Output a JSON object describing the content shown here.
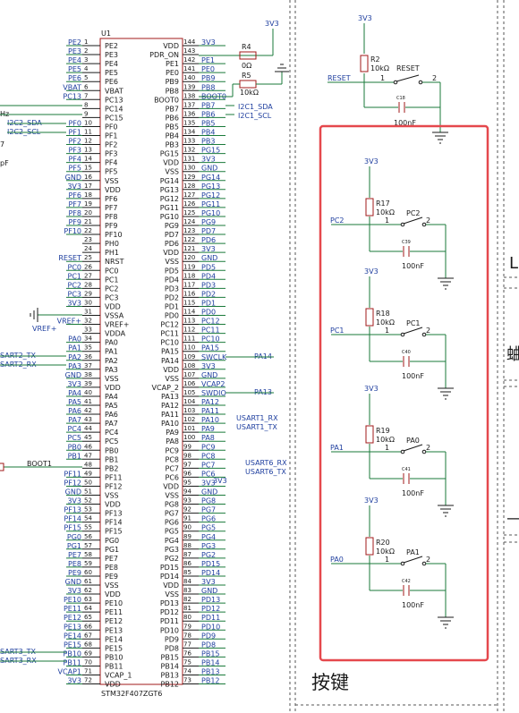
{
  "mcu": {
    "designator": "U1",
    "part": "STM32F407ZGT6",
    "left_pins": [
      {
        "num": "1",
        "name": "PE2",
        "net": "PE2"
      },
      {
        "num": "2",
        "name": "PE3",
        "net": "PE3"
      },
      {
        "num": "3",
        "name": "PE4",
        "net": "PE4"
      },
      {
        "num": "4",
        "name": "PE5",
        "net": "PE5"
      },
      {
        "num": "5",
        "name": "PE6",
        "net": "PE6"
      },
      {
        "num": "6",
        "name": "VBAT",
        "net": "VBAT"
      },
      {
        "num": "7",
        "name": "PC13",
        "net": "PC13"
      },
      {
        "num": "8",
        "name": "PC14",
        "net": ""
      },
      {
        "num": "9",
        "name": "PC15",
        "net": ""
      },
      {
        "num": "10",
        "name": "PF0",
        "net": "PF0"
      },
      {
        "num": "11",
        "name": "PF1",
        "net": "PF1"
      },
      {
        "num": "12",
        "name": "PF2",
        "net": "PF2"
      },
      {
        "num": "13",
        "name": "PF3",
        "net": "PF3"
      },
      {
        "num": "14",
        "name": "PF4",
        "net": "PF4"
      },
      {
        "num": "15",
        "name": "PF5",
        "net": "PF5"
      },
      {
        "num": "16",
        "name": "VSS",
        "net": "GND"
      },
      {
        "num": "17",
        "name": "VDD",
        "net": "3V3"
      },
      {
        "num": "18",
        "name": "PF6",
        "net": "PF6"
      },
      {
        "num": "19",
        "name": "PF7",
        "net": "PF7"
      },
      {
        "num": "20",
        "name": "PF8",
        "net": "PF8"
      },
      {
        "num": "21",
        "name": "PF9",
        "net": "PF9"
      },
      {
        "num": "22",
        "name": "PF10",
        "net": "PF10"
      },
      {
        "num": "23",
        "name": "PH0",
        "net": ""
      },
      {
        "num": "24",
        "name": "PH1",
        "net": ""
      },
      {
        "num": "25",
        "name": "NRST",
        "net": "RESET"
      },
      {
        "num": "26",
        "name": "PC0",
        "net": "PC0"
      },
      {
        "num": "27",
        "name": "PC1",
        "net": "PC1"
      },
      {
        "num": "28",
        "name": "PC2",
        "net": "PC2"
      },
      {
        "num": "29",
        "name": "PC3",
        "net": "PC3"
      },
      {
        "num": "30",
        "name": "VDD",
        "net": "3V3"
      },
      {
        "num": "31",
        "name": "VSSA",
        "net": ""
      },
      {
        "num": "32",
        "name": "VREF+",
        "net": "VREF+"
      },
      {
        "num": "33",
        "name": "VDDA",
        "net": ""
      },
      {
        "num": "34",
        "name": "PA0",
        "net": "PA0"
      },
      {
        "num": "35",
        "name": "PA1",
        "net": "PA1"
      },
      {
        "num": "36",
        "name": "PA2",
        "net": "PA2"
      },
      {
        "num": "37",
        "name": "PA3",
        "net": "PA3"
      },
      {
        "num": "38",
        "name": "VSS",
        "net": "GND"
      },
      {
        "num": "39",
        "name": "VDD",
        "net": "3V3"
      },
      {
        "num": "40",
        "name": "PA4",
        "net": "PA4"
      },
      {
        "num": "41",
        "name": "PA5",
        "net": "PA5"
      },
      {
        "num": "42",
        "name": "PA6",
        "net": "PA6"
      },
      {
        "num": "43",
        "name": "PA7",
        "net": "PA7"
      },
      {
        "num": "44",
        "name": "PC4",
        "net": "PC4"
      },
      {
        "num": "45",
        "name": "PC5",
        "net": "PC5"
      },
      {
        "num": "46",
        "name": "PB0",
        "net": "PB0"
      },
      {
        "num": "47",
        "name": "PB1",
        "net": "PB1"
      },
      {
        "num": "48",
        "name": "PB2",
        "net": ""
      },
      {
        "num": "49",
        "name": "PF11",
        "net": "PF11"
      },
      {
        "num": "50",
        "name": "PF12",
        "net": "PF12"
      },
      {
        "num": "51",
        "name": "VSS",
        "net": "GND"
      },
      {
        "num": "52",
        "name": "VDD",
        "net": "3V3"
      },
      {
        "num": "53",
        "name": "PF13",
        "net": "PF13"
      },
      {
        "num": "54",
        "name": "PF14",
        "net": "PF14"
      },
      {
        "num": "55",
        "name": "PF15",
        "net": "PF15"
      },
      {
        "num": "56",
        "name": "PG0",
        "net": "PG0"
      },
      {
        "num": "57",
        "name": "PG1",
        "net": "PG1"
      },
      {
        "num": "58",
        "name": "PE7",
        "net": "PE7"
      },
      {
        "num": "59",
        "name": "PE8",
        "net": "PE8"
      },
      {
        "num": "60",
        "name": "PE9",
        "net": "PE9"
      },
      {
        "num": "61",
        "name": "VSS",
        "net": "GND"
      },
      {
        "num": "62",
        "name": "VDD",
        "net": "3V3"
      },
      {
        "num": "63",
        "name": "PE10",
        "net": "PE10"
      },
      {
        "num": "64",
        "name": "PE11",
        "net": "PE11"
      },
      {
        "num": "65",
        "name": "PE12",
        "net": "PE12"
      },
      {
        "num": "66",
        "name": "PE13",
        "net": "PE13"
      },
      {
        "num": "67",
        "name": "PE14",
        "net": "PE14"
      },
      {
        "num": "68",
        "name": "PE15",
        "net": "PE15"
      },
      {
        "num": "69",
        "name": "PB10",
        "net": "PB10"
      },
      {
        "num": "70",
        "name": "PB11",
        "net": "PB11"
      },
      {
        "num": "71",
        "name": "VCAP_1",
        "net": "VCAP1"
      },
      {
        "num": "72",
        "name": "VDD",
        "net": "3V3"
      }
    ],
    "right_pins": [
      {
        "num": "144",
        "name": "VDD",
        "net": "3V3"
      },
      {
        "num": "143",
        "name": "PDR_ON",
        "net": ""
      },
      {
        "num": "142",
        "name": "PE1",
        "net": "PE1"
      },
      {
        "num": "141",
        "name": "PE0",
        "net": "PE0"
      },
      {
        "num": "140",
        "name": "PB9",
        "net": "PB9"
      },
      {
        "num": "139",
        "name": "PB8",
        "net": "PB8"
      },
      {
        "num": "138",
        "name": "BOOT0",
        "net": "BOOT0"
      },
      {
        "num": "137",
        "name": "PB7",
        "net": "PB7"
      },
      {
        "num": "136",
        "name": "PB6",
        "net": "PB6"
      },
      {
        "num": "135",
        "name": "PB5",
        "net": "PB5"
      },
      {
        "num": "134",
        "name": "PB4",
        "net": "PB4"
      },
      {
        "num": "133",
        "name": "PB3",
        "net": "PB3"
      },
      {
        "num": "132",
        "name": "PG15",
        "net": "PG15"
      },
      {
        "num": "131",
        "name": "VDD",
        "net": "3V3"
      },
      {
        "num": "130",
        "name": "VSS",
        "net": "GND"
      },
      {
        "num": "129",
        "name": "PG14",
        "net": "PG14"
      },
      {
        "num": "128",
        "name": "PG13",
        "net": "PG13"
      },
      {
        "num": "127",
        "name": "PG12",
        "net": "PG12"
      },
      {
        "num": "126",
        "name": "PG11",
        "net": "PG11"
      },
      {
        "num": "125",
        "name": "PG10",
        "net": "PG10"
      },
      {
        "num": "124",
        "name": "PG9",
        "net": "PG9"
      },
      {
        "num": "123",
        "name": "PD7",
        "net": "PD7"
      },
      {
        "num": "122",
        "name": "PD6",
        "net": "PD6"
      },
      {
        "num": "121",
        "name": "VDD",
        "net": "3V3"
      },
      {
        "num": "120",
        "name": "VSS",
        "net": "GND"
      },
      {
        "num": "119",
        "name": "PD5",
        "net": "PD5"
      },
      {
        "num": "118",
        "name": "PD4",
        "net": "PD4"
      },
      {
        "num": "117",
        "name": "PD3",
        "net": "PD3"
      },
      {
        "num": "116",
        "name": "PD2",
        "net": "PD2"
      },
      {
        "num": "115",
        "name": "PD1",
        "net": "PD1"
      },
      {
        "num": "114",
        "name": "PD0",
        "net": "PD0"
      },
      {
        "num": "113",
        "name": "PC12",
        "net": "PC12"
      },
      {
        "num": "112",
        "name": "PC11",
        "net": "PC11"
      },
      {
        "num": "111",
        "name": "PC10",
        "net": "PC10"
      },
      {
        "num": "110",
        "name": "PA15",
        "net": "PA15"
      },
      {
        "num": "109",
        "name": "PA14",
        "net": "SWCLK"
      },
      {
        "num": "108",
        "name": "VDD",
        "net": "3V3"
      },
      {
        "num": "107",
        "name": "VSS",
        "net": "GND"
      },
      {
        "num": "106",
        "name": "VCAP_2",
        "net": "VCAP2"
      },
      {
        "num": "105",
        "name": "PA13",
        "net": "SWDIO"
      },
      {
        "num": "104",
        "name": "PA12",
        "net": "PA12"
      },
      {
        "num": "103",
        "name": "PA11",
        "net": "PA11"
      },
      {
        "num": "102",
        "name": "PA10",
        "net": "PA10"
      },
      {
        "num": "101",
        "name": "PA9",
        "net": "PA9"
      },
      {
        "num": "100",
        "name": "PA8",
        "net": "PA8"
      },
      {
        "num": "99",
        "name": "PC9",
        "net": "PC9"
      },
      {
        "num": "98",
        "name": "PC8",
        "net": "PC8"
      },
      {
        "num": "97",
        "name": "PC7",
        "net": "PC7"
      },
      {
        "num": "96",
        "name": "PC6",
        "net": "PC6"
      },
      {
        "num": "95",
        "name": "VDD",
        "net": "3V3"
      },
      {
        "num": "94",
        "name": "VSS",
        "net": "GND"
      },
      {
        "num": "93",
        "name": "PG8",
        "net": "PG8"
      },
      {
        "num": "92",
        "name": "PG7",
        "net": "PG7"
      },
      {
        "num": "91",
        "name": "PG6",
        "net": "PG6"
      },
      {
        "num": "90",
        "name": "PG5",
        "net": "PG5"
      },
      {
        "num": "89",
        "name": "PG4",
        "net": "PG4"
      },
      {
        "num": "88",
        "name": "PG3",
        "net": "PG3"
      },
      {
        "num": "87",
        "name": "PG2",
        "net": "PG2"
      },
      {
        "num": "86",
        "name": "PD15",
        "net": "PD15"
      },
      {
        "num": "85",
        "name": "PD14",
        "net": "PD14"
      },
      {
        "num": "84",
        "name": "VDD",
        "net": "3V3"
      },
      {
        "num": "83",
        "name": "VSS",
        "net": "GND"
      },
      {
        "num": "82",
        "name": "PD13",
        "net": "PD13"
      },
      {
        "num": "81",
        "name": "PD12",
        "net": "PD12"
      },
      {
        "num": "80",
        "name": "PD11",
        "net": "PD11"
      },
      {
        "num": "79",
        "name": "PD10",
        "net": "PD10"
      },
      {
        "num": "78",
        "name": "PD9",
        "net": "PD9"
      },
      {
        "num": "77",
        "name": "PD8",
        "net": "PD8"
      },
      {
        "num": "76",
        "name": "PB15",
        "net": "PB15"
      },
      {
        "num": "75",
        "name": "PB14",
        "net": "PB14"
      },
      {
        "num": "74",
        "name": "PB13",
        "net": "PB13"
      },
      {
        "num": "73",
        "name": "PB12",
        "net": "PB12"
      }
    ]
  },
  "left_side_labels": {
    "i2c2_sda": "I2C2_SDA",
    "i2c2_scl": "I2C2_SCL",
    "vref_net": "VREF+",
    "uart2_tx": "SART2_TX",
    "uart2_rx": "SART2_RX",
    "boot1": "BOOT1",
    "uart3_tx": "SART3_TX",
    "uart3_rx": "SART3_RX",
    "clip_hz": "Hz",
    "clip_7": "7",
    "clip_pf": "pF"
  },
  "right_side_labels": {
    "vdd_top": "3V3",
    "r4": "R4",
    "r4_value": "0Ω",
    "r5": "R5",
    "r5_value": "10kΩ",
    "i2c1_sda": "I2C1_SDA",
    "i2c1_scl": "I2C1_SCL",
    "swclk_net": "PA14",
    "swdio_net": "PA13",
    "usart1_rx": "USART1_RX",
    "usart1_tx": "USART1_TX",
    "usart6_rx": "USART6_RX",
    "usart6_tx": "USART6_TX",
    "vcap2_supply": "3V3"
  },
  "reset_circuit": {
    "supply": "3V3",
    "resistor": "R2",
    "resistor_value": "10kΩ",
    "switch": "RESET",
    "pin1": "1",
    "pin2": "2",
    "net": "RESET",
    "capacitor": "C18",
    "cap_value": "100nF"
  },
  "buttons": [
    {
      "supply": "3V3",
      "resistor": "R17",
      "value": "10kΩ",
      "switch": "PC2",
      "net": "PC2",
      "cap": "C39",
      "cap_value": "100nF",
      "pin1": "1",
      "pin2": "2"
    },
    {
      "supply": "3V3",
      "resistor": "R18",
      "value": "10kΩ",
      "switch": "PC1",
      "net": "PC1",
      "cap": "C40",
      "cap_value": "100nF",
      "pin1": "1",
      "pin2": "2"
    },
    {
      "supply": "3V3",
      "resistor": "R19",
      "value": "10kΩ",
      "switch": "PA0",
      "net": "PA1",
      "cap": "C41",
      "cap_value": "100nF",
      "pin1": "1",
      "pin2": "2"
    },
    {
      "supply": "3V3",
      "resistor": "R20",
      "value": "10kΩ",
      "switch": "PA1",
      "net": "PA0",
      "cap": "C42",
      "cap_value": "100nF",
      "pin1": "1",
      "pin2": "2"
    }
  ],
  "section_title": "按键",
  "right_edge_clips": [
    "L",
    "蛐",
    "—"
  ],
  "colors": {
    "wire": "#1a7a3a",
    "net_label": "#1f3f9f",
    "outline": "#e5484d",
    "component": "#a01818",
    "text": "#1a1a1a"
  }
}
